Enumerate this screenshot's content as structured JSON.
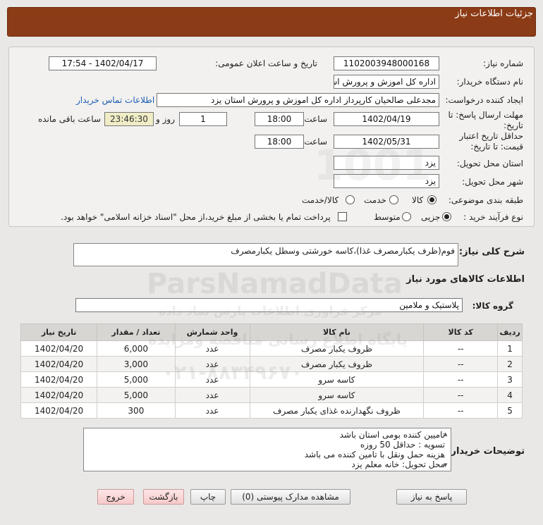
{
  "header": {
    "title": "جزئیات اطلاعات نیاز"
  },
  "fields": {
    "need_number_label": "شماره نیاز:",
    "need_number": "1102003948000168",
    "announce_label": "تاریخ و ساعت اعلان عمومی:",
    "announce_value": "1402/04/17 - 17:54",
    "buyer_org_label": "نام دستگاه خریدار:",
    "buyer_org": "اداره کل اموزش و پرورش استان یزد",
    "requester_label": "ایجاد کننده درخواست:",
    "requester": "مجدعلی صالحیان کارپرداز اداره کل اموزش و پرورش استان یزد",
    "contact_link": "اطلاعات تماس خریدار",
    "deadline_label": "مهلت ارسال پاسخ: تا تاریخ:",
    "deadline_date": "1402/04/19",
    "time_label": "ساعت",
    "deadline_time": "18:00",
    "days_value": "1",
    "days_label": "روز و",
    "remaining_time": "23:46:30",
    "remaining_label": "ساعت باقی مانده",
    "validity_label": "حداقل تاریخ اعتبار قیمت: تا تاریخ:",
    "validity_date": "1402/05/31",
    "validity_time_label": "ساعت",
    "validity_time": "18:00",
    "province_label": "استان محل تحویل:",
    "province": "یزد",
    "city_label": "شهر محل تحویل:",
    "city": "یزد",
    "category_label": "طبقه بندی موضوعی:",
    "category_options": [
      "کالا",
      "خدمت",
      "کالا/خدمت"
    ],
    "category_selected": "کالا",
    "process_label": "نوع فرآیند خرید :",
    "process_options": [
      "جزیی",
      "متوسط"
    ],
    "process_selected": "جزیی",
    "payment_note": "پرداخت تمام یا بخشی از مبلغ خرید،از محل \"اسناد خزانه اسلامی\" خواهد بود."
  },
  "summary": {
    "label": "شرح کلی نیاز:",
    "value": "فوم(ظرف یکبارمصرف غذا)،کاسه خورشتی وسطل یکبارمصرف"
  },
  "goods_section": {
    "title": "اطلاعات کالاهای مورد نیاز",
    "group_label": "گروه کالا:",
    "group_value": "پلاستیک و ملامین"
  },
  "table": {
    "headers": [
      "ردیف",
      "کد کالا",
      "نام کالا",
      "واحد شمارش",
      "تعداد / مقدار",
      "تاریخ نیاز"
    ],
    "rows": [
      [
        "1",
        "--",
        "ظروف یکبار مصرف",
        "عدد",
        "6,000",
        "1402/04/20"
      ],
      [
        "2",
        "--",
        "ظروف یکبار مصرف",
        "عدد",
        "3,000",
        "1402/04/20"
      ],
      [
        "3",
        "--",
        "کاسه سرو",
        "عدد",
        "5,000",
        "1402/04/20"
      ],
      [
        "4",
        "--",
        "کاسه سرو",
        "عدد",
        "5,000",
        "1402/04/20"
      ],
      [
        "5",
        "--",
        "ظروف نگهدارنده غذای یکبار مصرف",
        "عدد",
        "300",
        "1402/04/20"
      ]
    ]
  },
  "buyer_notes": {
    "label": "توضیحات خریدار:",
    "lines": [
      "تامیین کننده بومی استان باشد",
      "تسویه : حداقل 50 روزه",
      "هزینه حمل ونقل با تامین کننده می باشد",
      "محل تحویل: خانه معلم یزد"
    ]
  },
  "buttons": {
    "reply": "پاسخ به نیاز",
    "attachments": "مشاهده مدارک پیوستی (0)",
    "print": "چاپ",
    "back": "بازگشت",
    "exit": "خروج"
  },
  "watermark": {
    "brand": "ParsNamadData",
    "line1": "مرکز فراوری اطلاعات پارس نماد داده",
    "line2": "پایگاه اطلاع رسانی مناقصه ومزایده",
    "phone": "۰۲۱-۸۸۳۴۹۶۷۰"
  }
}
